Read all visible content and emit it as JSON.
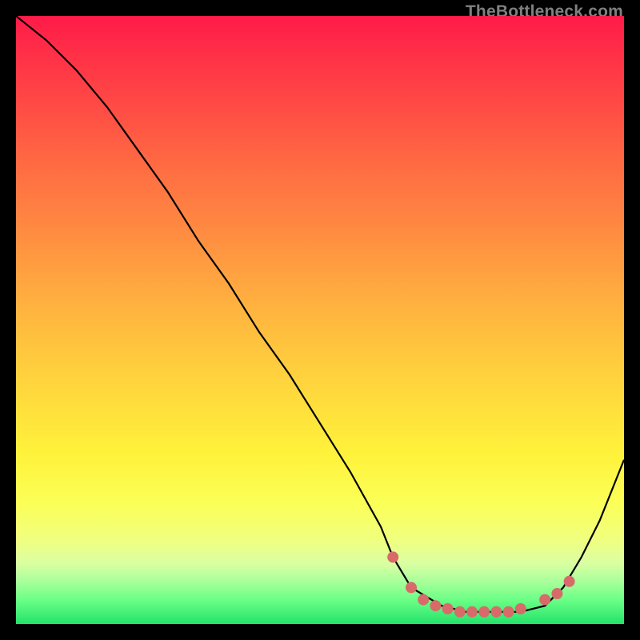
{
  "watermark": "TheBottleneck.com",
  "chart_data": {
    "type": "line",
    "title": "",
    "xlabel": "",
    "ylabel": "",
    "xlim": [
      0,
      100
    ],
    "ylim": [
      0,
      100
    ],
    "series": [
      {
        "name": "bottleneck-curve",
        "color": "#000000",
        "x": [
          0,
          5,
          10,
          15,
          20,
          25,
          30,
          35,
          40,
          45,
          50,
          55,
          60,
          62,
          65,
          70,
          74,
          77,
          80,
          83,
          87,
          90,
          93,
          96,
          100
        ],
        "values": [
          100,
          96,
          91,
          85,
          78,
          71,
          63,
          56,
          48,
          41,
          33,
          25,
          16,
          11,
          6,
          3,
          2,
          2,
          2,
          2,
          3,
          6,
          11,
          17,
          27
        ]
      }
    ],
    "markers": {
      "name": "highlight-dots",
      "color": "#d86a6a",
      "radius": 7,
      "points": [
        {
          "x": 62,
          "y": 11
        },
        {
          "x": 65,
          "y": 6
        },
        {
          "x": 67,
          "y": 4
        },
        {
          "x": 69,
          "y": 3
        },
        {
          "x": 71,
          "y": 2.5
        },
        {
          "x": 73,
          "y": 2
        },
        {
          "x": 75,
          "y": 2
        },
        {
          "x": 77,
          "y": 2
        },
        {
          "x": 79,
          "y": 2
        },
        {
          "x": 81,
          "y": 2
        },
        {
          "x": 83,
          "y": 2.5
        },
        {
          "x": 87,
          "y": 4
        },
        {
          "x": 89,
          "y": 5
        },
        {
          "x": 91,
          "y": 7
        }
      ]
    }
  }
}
